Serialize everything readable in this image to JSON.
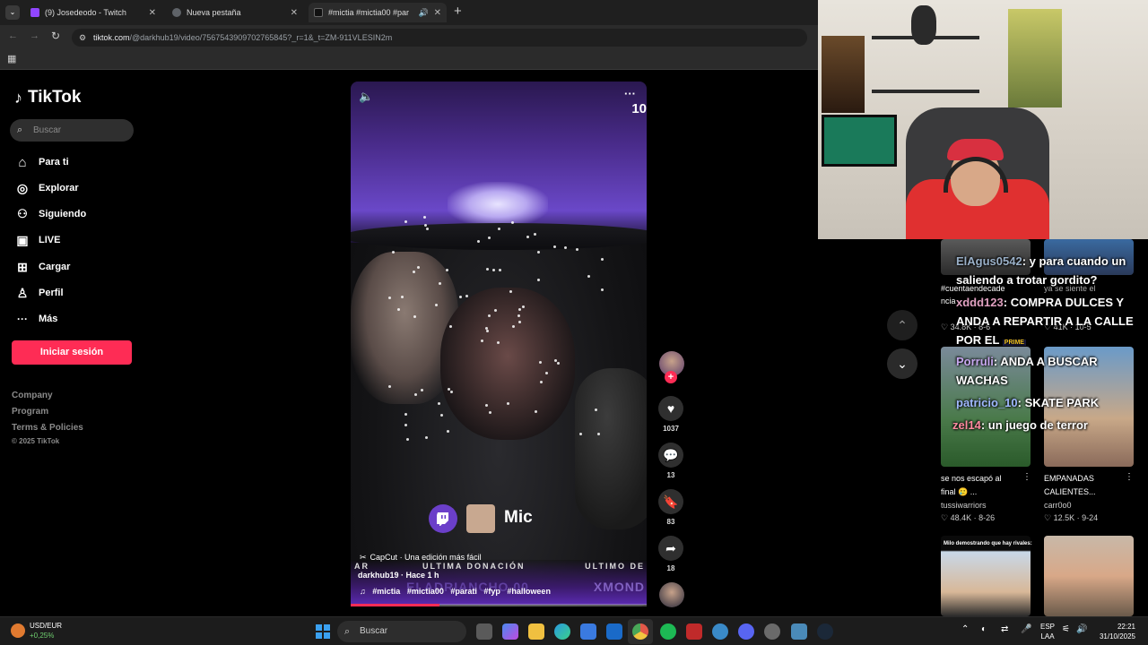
{
  "browser": {
    "tabs": [
      {
        "title": "(9) Josedeodo - Twitch",
        "favicon_color": "#9146ff"
      },
      {
        "title": "Nueva pestaña",
        "favicon_color": "#5f6368"
      },
      {
        "title": "#mictia #mictia00 #par",
        "favicon_color": "#000000"
      }
    ],
    "new_tab": "+",
    "url_host": "tiktok.com",
    "url_path": "/@darkhub19/video/7567543909702765845?_r=1&_t=ZM-911VLESIN2m"
  },
  "tiktok": {
    "logo": "TikTok",
    "search_placeholder": "Buscar",
    "nav": [
      {
        "label": "Para ti",
        "icon": "home-icon",
        "glyph": "⌂"
      },
      {
        "label": "Explorar",
        "icon": "compass-icon",
        "glyph": "◎"
      },
      {
        "label": "Siguiendo",
        "icon": "following-icon",
        "glyph": "👤"
      },
      {
        "label": "LIVE",
        "icon": "live-icon",
        "glyph": "▣"
      },
      {
        "label": "Cargar",
        "icon": "upload-icon",
        "glyph": "⊞"
      },
      {
        "label": "Perfil",
        "icon": "profile-icon",
        "glyph": "♙"
      },
      {
        "label": "Más",
        "icon": "more-icon",
        "glyph": "···"
      }
    ],
    "login_button": "Iniciar sesión",
    "footer": [
      "Company",
      "Program",
      "Terms & Policies"
    ],
    "copyright": "© 2025 TikTok"
  },
  "video": {
    "overlay_text": "Mic",
    "donation_left": "AR",
    "donation_mid": "ULTIMA DONACIÓN",
    "donation_right": "ULTIMO DE",
    "donation_name": "ELADRIANCHO 00",
    "donation_name2": "XMOND",
    "capcut": "CapCut · Una edición más fácil",
    "author_line": "darkhub19 · Hace 1 h",
    "hashtags": [
      "#mictia",
      "#mictia00",
      "#parati",
      "#fyp",
      "#halloween"
    ],
    "progress": 0.3,
    "top_digits": "10"
  },
  "actions": {
    "likes": "1037",
    "comments": "13",
    "saves": "83",
    "shares": "18",
    "follow_plus": "+"
  },
  "feed": [
    {
      "caption_lines": [
        "#cuentaendecade",
        "ncia"
      ],
      "meta": "34.8K · 8-6"
    },
    {
      "caption_lines": [
        "ya se siente el"
      ],
      "meta": "41K · 10-5"
    },
    {
      "caption_lines": [
        "se nos escapó al",
        "final 🥲 ..."
      ],
      "author": "tussiwarriors",
      "meta": "48.4K · 8-26"
    },
    {
      "caption_lines": [
        "EMPANADAS",
        "CALIENTES..."
      ],
      "author": "carr0o0",
      "meta": "12.5K · 9-24"
    },
    {
      "caption_lines": [
        "Milo demostrando que hay rivales:"
      ]
    }
  ],
  "chat": [
    {
      "user": "ElAgus0542",
      "user_color": "#9ab0c8",
      "text": ": y para cuando un saliendo a trotar gordito?"
    },
    {
      "user": "xddd123",
      "user_color": "#e0a0c0",
      "text": ": COMPRA DULCES Y ANDA A REPARTIR A LA CALLE POR EL"
    },
    {
      "user": "Porruli",
      "user_color": "#c8a8f0",
      "text": ": ANDA A BUSCAR WACHAS"
    },
    {
      "user": "patricio_10",
      "user_color": "#a0b8ff",
      "text": ": SKATE PARK"
    },
    {
      "user": "zel14",
      "user_color": "#ff8aa0",
      "text": ": un juego de terror"
    }
  ],
  "chat_badge": "PRIME",
  "taskbar": {
    "ticker": "USD/EUR",
    "ticker_change": "+0,25%",
    "search": "Buscar",
    "lang_top": "ESP",
    "lang_bottom": "LAA",
    "time": "22:21",
    "date": "31/10/2025"
  }
}
